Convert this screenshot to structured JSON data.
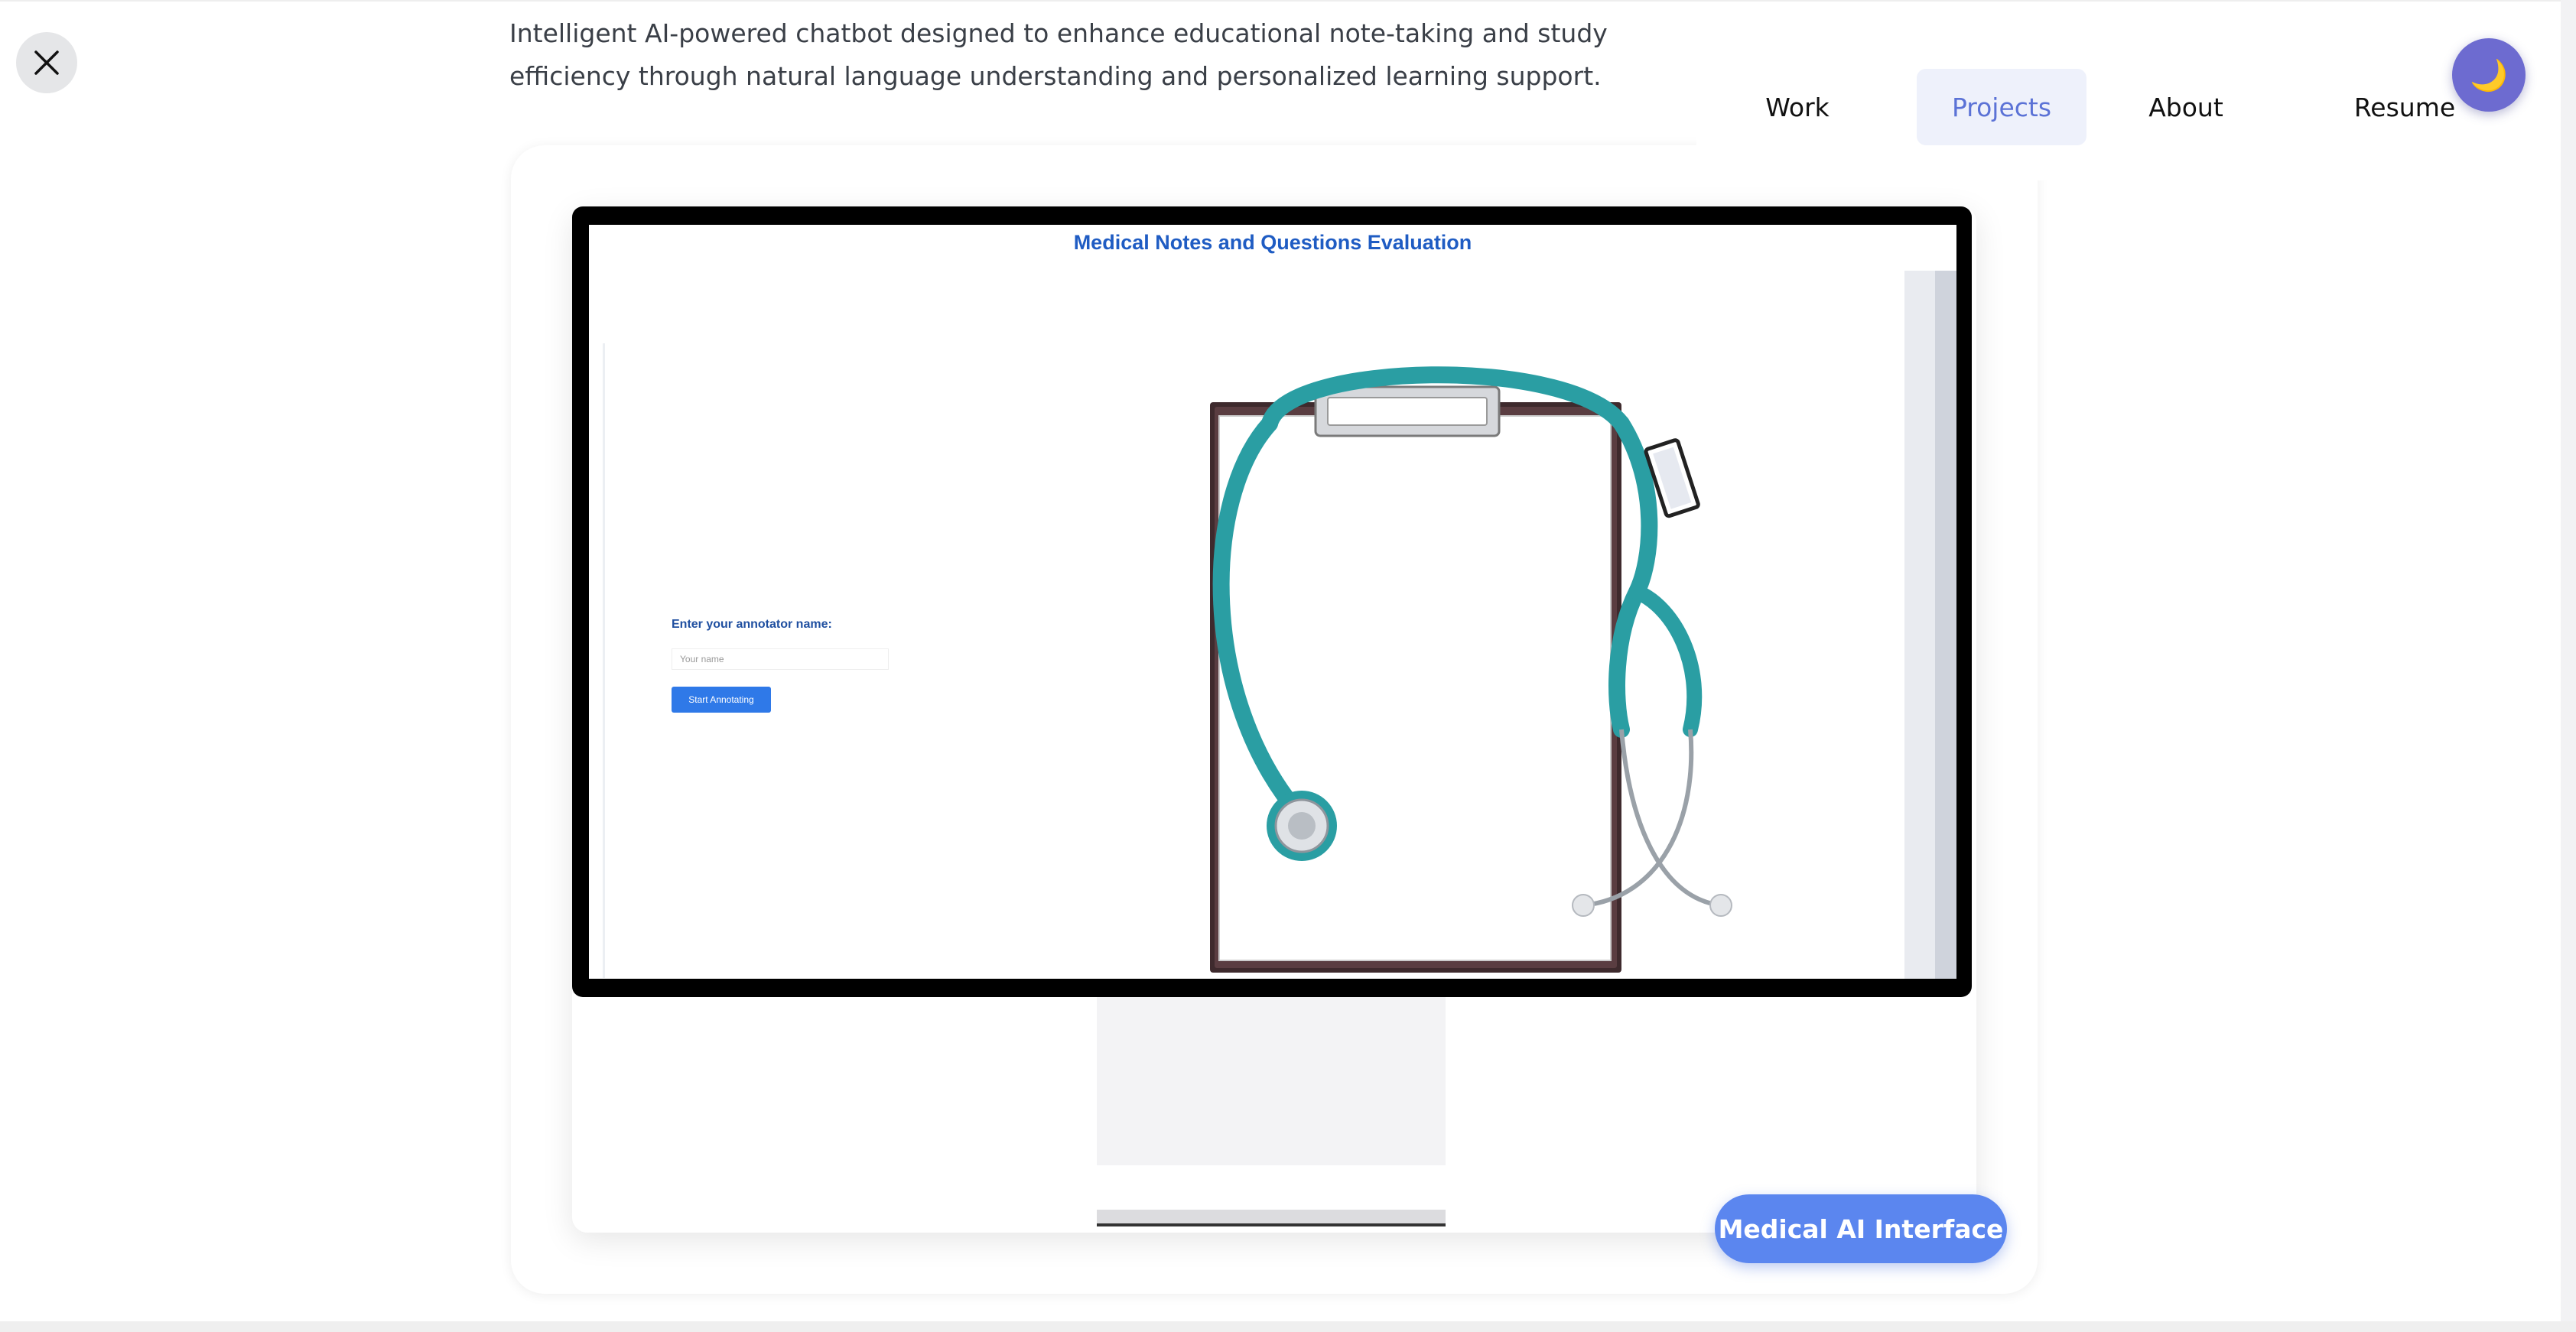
{
  "project": {
    "description": "Intelligent AI-powered chatbot designed to enhance educational note-taking and study efficiency through natural language understanding and personalized learning support.",
    "tag": "Medical AI Interface"
  },
  "nav": {
    "items": [
      {
        "label": "Work"
      },
      {
        "label": "Projects",
        "active": true
      },
      {
        "label": "About"
      },
      {
        "label": "Resume"
      }
    ],
    "theme_icon": "moon-icon",
    "theme_glyph": "🌙"
  },
  "close_icon": "close-icon",
  "screen": {
    "title": "Medical Notes and Questions Evaluation",
    "form_label": "Enter your annotator name:",
    "input_placeholder": "Your name",
    "button_label": "Start Annotating",
    "image_subject": "stethoscope-clipboard-image"
  },
  "colors": {
    "accent": "#5b86ef",
    "nav_active_text": "#5b72d6",
    "nav_active_bg": "#eef1fb",
    "screen_title": "#1f5cc3",
    "start_button": "#2f79e8",
    "toggle": "#6d6bd0",
    "stethoscope": "#2a9ea3"
  }
}
